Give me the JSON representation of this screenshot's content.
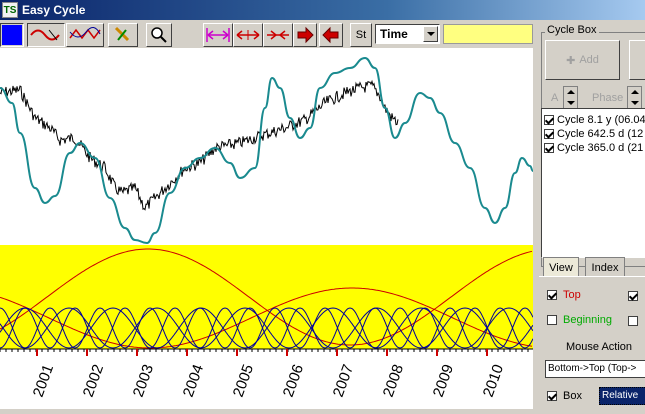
{
  "window": {
    "title": "Easy Cycle",
    "icon_text": "TS"
  },
  "toolbar": {
    "st_label": "St",
    "mode_select": "Time"
  },
  "chart": {
    "years": [
      "2001",
      "2002",
      "2003",
      "2004",
      "2005",
      "2006",
      "2007",
      "2008",
      "2009",
      "2010"
    ],
    "colors": {
      "price": "#000000",
      "composite": "#1a8a8f",
      "subpanel_bg": "#ffff00",
      "long_cycle": "#cc0000",
      "short_cycles": "#000099"
    }
  },
  "cycle_box": {
    "label": "Cycle Box",
    "add_label": "Add",
    "a_label": "A",
    "phase_label": "Phase",
    "cycles": [
      {
        "label": "Cycle 8.1 y (06.04",
        "checked": true
      },
      {
        "label": "Cycle 642.5 d (12",
        "checked": true
      },
      {
        "label": "Cycle 365.0 d (21",
        "checked": true
      }
    ]
  },
  "tabs": {
    "view": "View",
    "index": "Index"
  },
  "view_panel": {
    "top_label": "Top",
    "beginning_label": "Beginning",
    "mouse_action_label": "Mouse Action",
    "mouse_action_value": "Bottom->Top (Top->",
    "box_label": "Box",
    "relative_label": "Relative"
  }
}
